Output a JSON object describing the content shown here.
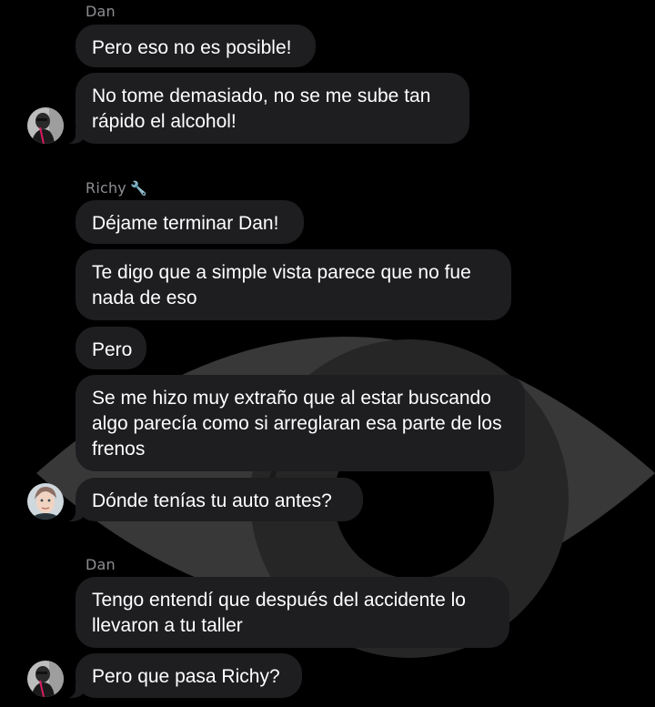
{
  "messages": [
    {
      "type": "sender",
      "name": "Dan"
    },
    {
      "type": "bubble",
      "text": "Pero eso no es posible!"
    },
    {
      "type": "bubble",
      "text": "No tome demasiado, no se me sube tan rápido el alcohol!"
    },
    {
      "type": "sender",
      "name": "Richy",
      "emoji": "🔧"
    },
    {
      "type": "bubble",
      "text": "Déjame terminar Dan!"
    },
    {
      "type": "bubble",
      "text": "Te digo que a simple vista parece que no fue nada de eso"
    },
    {
      "type": "bubble",
      "text": "Pero"
    },
    {
      "type": "bubble",
      "text": "Se me hizo muy extraño que al estar buscando algo parecía como si arreglaran esa parte de los frenos"
    },
    {
      "type": "bubble",
      "text": "Dónde tenías tu auto antes?"
    },
    {
      "type": "sender",
      "name": "Dan"
    },
    {
      "type": "bubble",
      "text": "Tengo entendí que después del accidente lo llevaron a tu taller"
    },
    {
      "type": "bubble",
      "text": "Pero que pasa Richy?"
    }
  ],
  "colors": {
    "background": "#000000",
    "bubble": "#1e1e21",
    "sender_label": "#8e8e93",
    "text": "#ffffff"
  }
}
